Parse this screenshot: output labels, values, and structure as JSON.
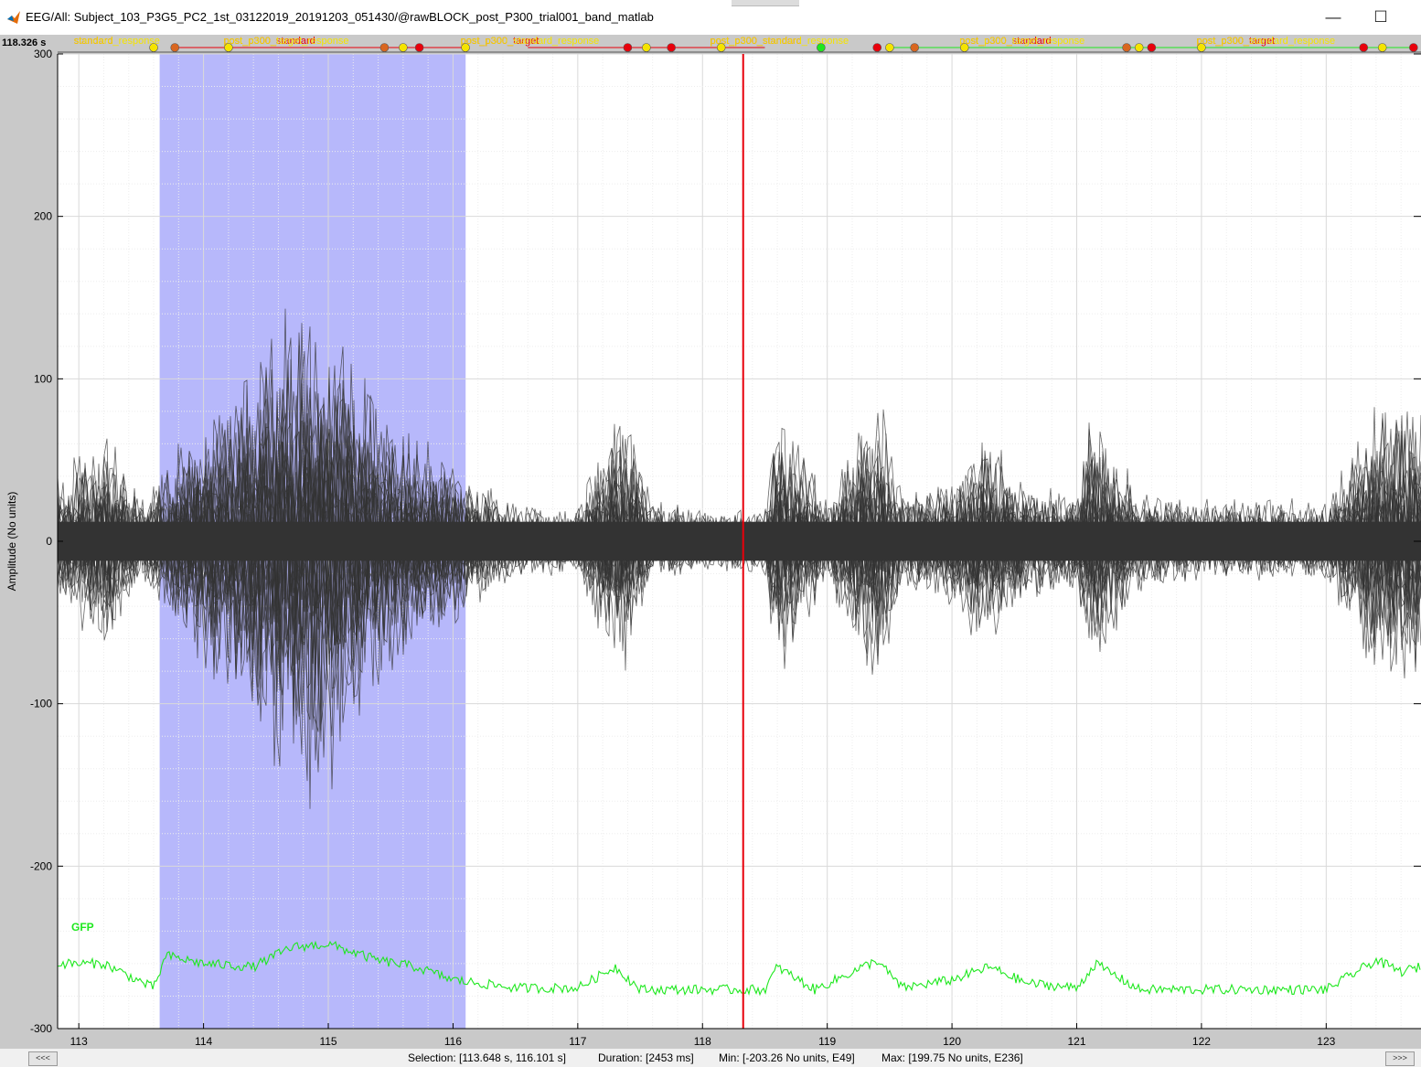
{
  "window": {
    "title": "EEG/All: Subject_103_P3G5_PC2_1st_03122019_20191203_051430/@rawBLOCK_post_P300_trial001_band_matlab",
    "minimize_glyph": "—",
    "maximize_glyph": "☐",
    "app_icon": "matlab-icon"
  },
  "figure": {
    "time_readout": "118.326 s",
    "gfp_label": "GFP",
    "scroll_left_label": "<<<",
    "scroll_right_label": ">>>"
  },
  "status": {
    "selection": "Selection: [113.648 s, 116.101 s]",
    "duration": "Duration: [2453 ms]",
    "min": "Min: [-203.26 No units, E49]",
    "max": "Max: [199.75 No units, E236]"
  },
  "events": [
    {
      "label": "standard_response",
      "overlap": "standard",
      "time": 113.4,
      "color": "#f5e400"
    },
    {
      "label": "post_p300_target_response",
      "overlap": "post_p300_standard",
      "time": 114.6,
      "color": "#f5e400"
    },
    {
      "label": "post_p300_standard_response",
      "overlap": "post_p300_target",
      "time": 116.5,
      "color": "#f5e400"
    },
    {
      "label": "post_p300_standard_response",
      "overlap": "post_p300_standard",
      "time": 118.5,
      "color": "#f5e400"
    },
    {
      "label": "post_p300_target_response",
      "overlap": "post_p300_standard",
      "time": 120.5,
      "color": "#f5e400"
    },
    {
      "label": "post_p300_standard_response",
      "overlap": "post_p300_target",
      "time": 122.4,
      "color": "#f5e400"
    }
  ],
  "colors": {
    "plot_bg": "#ffffff",
    "selection": "#b7b8fb",
    "trace": "#333333",
    "gfp": "#1ee81e",
    "cursor": "#e8000b",
    "event_yellow": "#f5e400",
    "event_red": "#e8000b",
    "event_orange": "#d9661f",
    "event_green": "#1ee81e"
  },
  "chart_data": {
    "type": "line",
    "title": "",
    "xlabel": "",
    "ylabel": "Amplitude (No units)",
    "xlim": [
      112.83,
      123.76
    ],
    "ylim": [
      -300,
      300
    ],
    "x_ticks": [
      113,
      114,
      115,
      116,
      117,
      118,
      119,
      120,
      121,
      122,
      123
    ],
    "y_ticks": [
      -300,
      -200,
      -100,
      0,
      100,
      200,
      300
    ],
    "grid": true,
    "selection_range": [
      113.648,
      116.101
    ],
    "cursor_time": 118.326,
    "amplitude_min": -203.26,
    "amplitude_max": 199.75,
    "series": [
      {
        "role": "eeg-overlay",
        "x": [
          112.85,
          113.2,
          113.5,
          113.9,
          114.2,
          114.5,
          114.9,
          115.2,
          115.5,
          115.8,
          116.1,
          116.5,
          117.0,
          117.35,
          117.6,
          118.0,
          118.5,
          118.6,
          119.0,
          119.4,
          119.6,
          120.0,
          120.2,
          120.6,
          121.0,
          121.1,
          121.5,
          122.0,
          122.5,
          123.0,
          123.4,
          123.7
        ],
        "envelope": [
          40,
          70,
          25,
          70,
          90,
          130,
          170,
          120,
          75,
          60,
          45,
          22,
          22,
          90,
          25,
          18,
          20,
          85,
          25,
          95,
          30,
          40,
          70,
          35,
          30,
          85,
          30,
          25,
          25,
          25,
          85,
          90
        ]
      },
      {
        "name": "GFP",
        "x": [
          112.85,
          113.2,
          113.6,
          113.7,
          114.0,
          114.4,
          114.7,
          115.0,
          115.4,
          115.7,
          116.0,
          116.5,
          117.0,
          117.3,
          117.5,
          118.0,
          118.5,
          118.6,
          118.9,
          119.4,
          119.6,
          120.0,
          120.3,
          120.6,
          121.0,
          121.15,
          121.5,
          122.0,
          122.5,
          123.0,
          123.4,
          123.6,
          123.76
        ],
        "values": [
          -260,
          -260,
          -275,
          -255,
          -260,
          -262,
          -250,
          -248,
          -258,
          -262,
          -270,
          -275,
          -275,
          -262,
          -276,
          -276,
          -276,
          -262,
          -276,
          -258,
          -275,
          -270,
          -262,
          -272,
          -275,
          -260,
          -276,
          -276,
          -276,
          -276,
          -258,
          -265,
          -262
        ]
      }
    ]
  }
}
